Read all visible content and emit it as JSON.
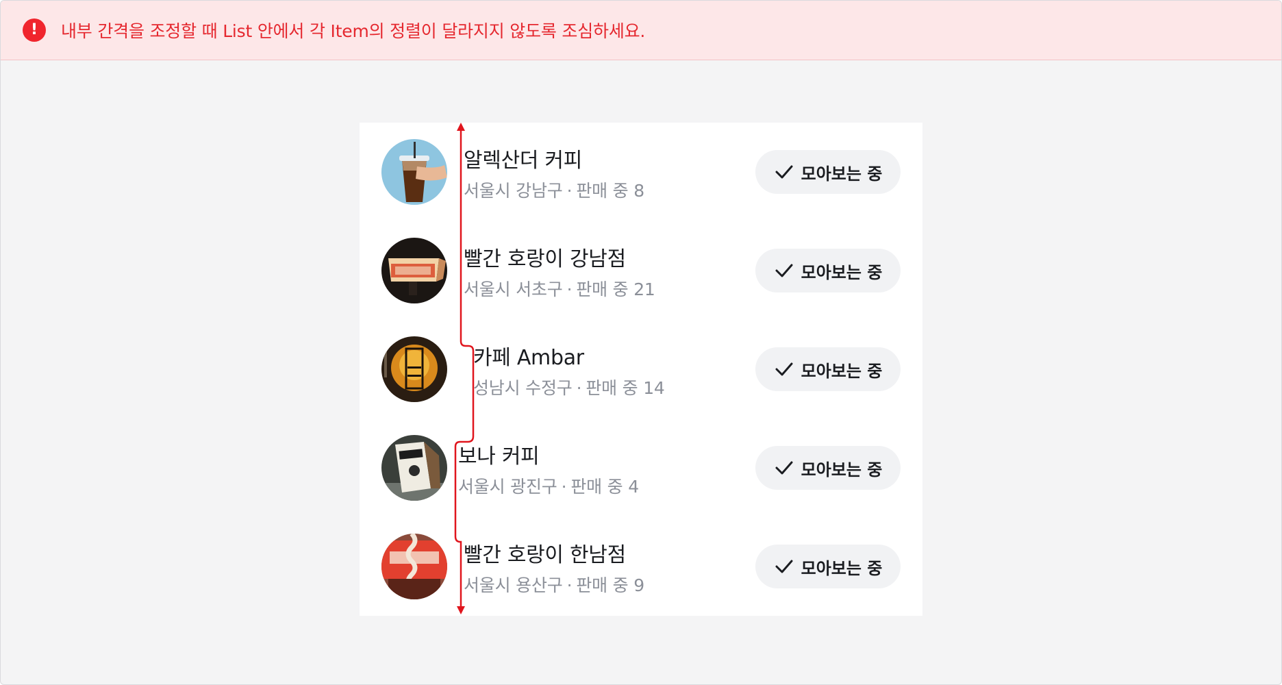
{
  "warning": {
    "icon": "exclamation-circle-icon",
    "text": "내부 간격을 조정할 때 List 안에서 각 Item의 정렬이 달라지지 않도록 조심하세요."
  },
  "list": {
    "items": [
      {
        "title": "알렉산더 커피",
        "location": "서울시 강남구",
        "separator": "·",
        "sales": "판매 중 8",
        "button": "모아보는 중"
      },
      {
        "title": "빨간 호랑이 강남점",
        "location": "서울시 서초구",
        "separator": "·",
        "sales": "판매 중 21",
        "button": "모아보는 중"
      },
      {
        "title": "카페 Ambar",
        "location": "성남시 수정구",
        "separator": "·",
        "sales": "판매 중 14",
        "button": "모아보는 중"
      },
      {
        "title": "보나 커피",
        "location": "서울시 광진구",
        "separator": "·",
        "sales": "판매 중 4",
        "button": "모아보는 중"
      },
      {
        "title": "빨간 호랑이 한남점",
        "location": "서울시 용산구",
        "separator": "·",
        "sales": "판매 중 9",
        "button": "모아보는 중"
      }
    ]
  },
  "colors": {
    "warning_text": "#e5282f",
    "warning_bg": "#fde7e8",
    "guide_line": "#e0151d",
    "button_bg": "#f1f2f4"
  }
}
